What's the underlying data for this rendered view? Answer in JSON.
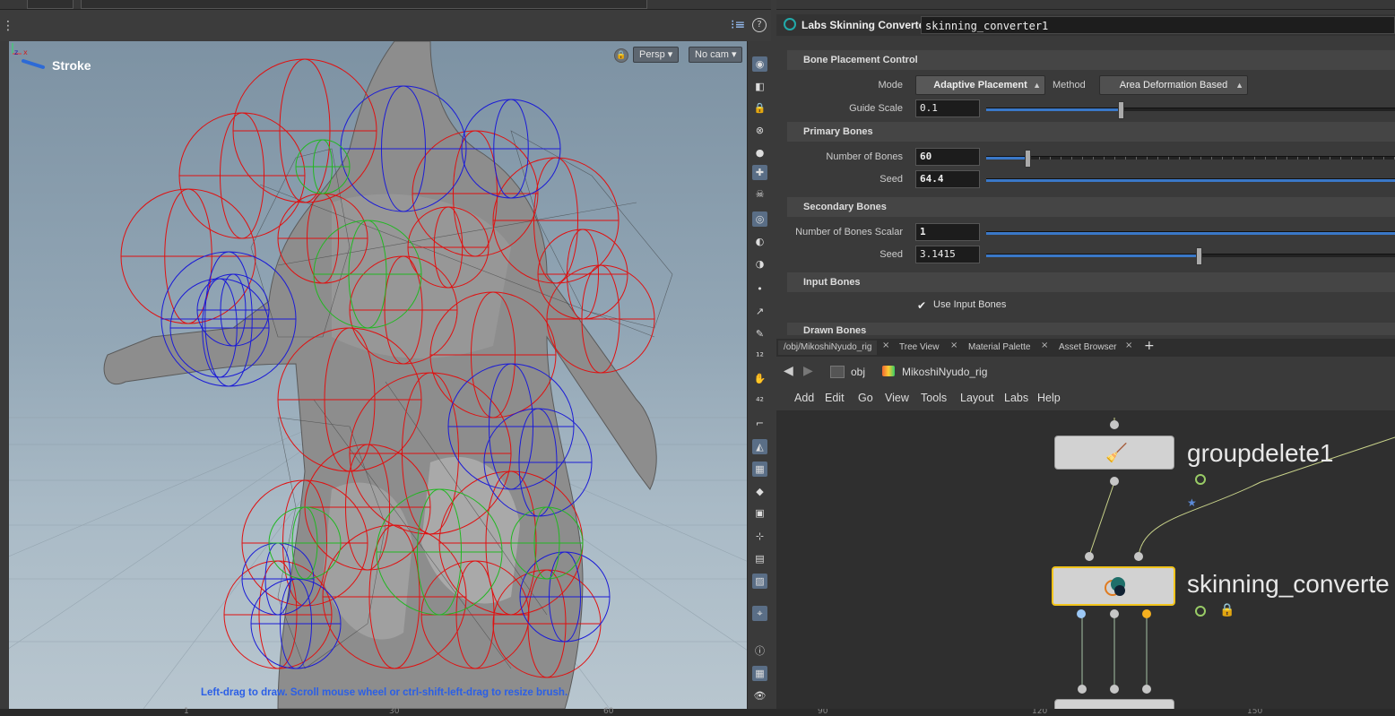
{
  "viewport": {
    "tool_label": "Stroke",
    "persp_label": "Persp",
    "cam_label": "No cam",
    "hint": "Left-drag to draw.  Scroll mouse wheel or ctrl-shift-left-drag to resize brush."
  },
  "timeline": {
    "ticks": [
      "1",
      "30",
      "60",
      "90",
      "120",
      "150"
    ]
  },
  "params": {
    "node_type": "Labs Skinning Converter",
    "node_name": "skinning_converter1",
    "sections": {
      "bone_placement": "Bone Placement Control",
      "primary": "Primary Bones",
      "secondary": "Secondary Bones",
      "input": "Input Bones",
      "drawn": "Drawn Bones"
    },
    "mode_label": "Mode",
    "mode_value": "Adaptive Placement",
    "method_label": "Method",
    "method_value": "Area Deformation Based",
    "guide_scale_label": "Guide Scale",
    "guide_scale_value": "0.1",
    "guide_scale_level": 0.33,
    "num_bones_label": "Number of Bones",
    "num_bones_value": "60",
    "num_bones_level": 0.1,
    "seed1_label": "Seed",
    "seed1_value": "64.4",
    "nb_scalar_label": "Number of Bones Scalar",
    "nb_scalar_value": "1",
    "seed2_label": "Seed",
    "seed2_value": "3.1415",
    "seed2_level": 0.52,
    "use_input_bones_label": "Use Input Bones",
    "use_input_bones_checked": true
  },
  "network": {
    "tabs": [
      "/obj/MikoshiNyudo_rig",
      "Tree View",
      "Material Palette",
      "Asset Browser"
    ],
    "path_root": "obj",
    "path_node": "MikoshiNyudo_rig",
    "menu": [
      "Add",
      "Edit",
      "Go",
      "View",
      "Tools",
      "Layout",
      "Labs",
      "Help"
    ],
    "nodes": [
      {
        "name": "groupdelete1"
      },
      {
        "name": "skinning_converte"
      }
    ]
  },
  "colors": {
    "accent_blue": "#3a78c8",
    "selected_node": "#f2c41b",
    "hint_blue": "#2b5fe6"
  }
}
